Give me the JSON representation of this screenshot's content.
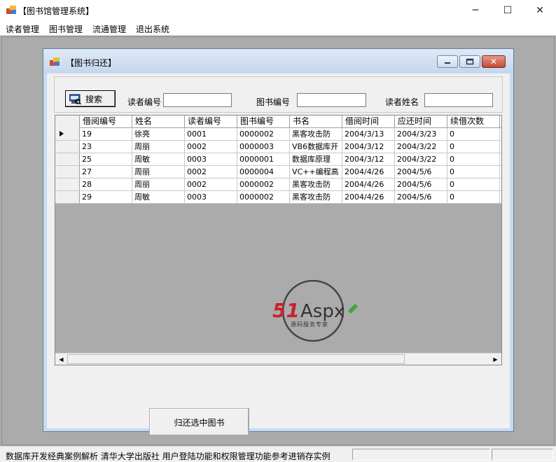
{
  "window": {
    "title": "【图书馆管理系统】",
    "minimize_glyph": "─",
    "maximize_glyph": "☐",
    "close_glyph": "✕"
  },
  "menu": [
    "读者管理",
    "图书管理",
    "流通管理",
    "退出系统"
  ],
  "child": {
    "title": "【图书归还】",
    "close_glyph": "✕"
  },
  "search": {
    "button_label": "搜索",
    "reader_id_label": "读者编号",
    "reader_id_value": "",
    "book_id_label": "图书编号",
    "book_id_value": "",
    "reader_name_label": "读者姓名",
    "reader_name_value": ""
  },
  "grid": {
    "columns": [
      "借阅编号",
      "姓名",
      "读者编号",
      "图书编号",
      "书名",
      "借阅时间",
      "应还时间",
      "续借次数"
    ],
    "rows": [
      [
        "19",
        "徐亮",
        "0001",
        "0000002",
        "黑客攻击防",
        "2004/3/13",
        "2004/3/23",
        "0"
      ],
      [
        "23",
        "周丽",
        "0002",
        "0000003",
        "VB6数据库开",
        "2004/3/12",
        "2004/3/22",
        "0"
      ],
      [
        "25",
        "周敏",
        "0003",
        "0000001",
        "数据库原理",
        "2004/3/12",
        "2004/3/22",
        "0"
      ],
      [
        "27",
        "周丽",
        "0002",
        "0000004",
        "VC++编程高",
        "2004/4/26",
        "2004/5/6",
        "0"
      ],
      [
        "28",
        "周丽",
        "0002",
        "0000002",
        "黑客攻击防",
        "2004/4/26",
        "2004/5/6",
        "0"
      ],
      [
        "29",
        "周敏",
        "0003",
        "0000002",
        "黑客攻击防",
        "2004/4/26",
        "2004/5/6",
        "0"
      ]
    ]
  },
  "watermark": {
    "brand_red": "51",
    "brand_black": "Aspx",
    "slogan": "源码服务专家"
  },
  "return_button_label": "归还选中图书",
  "status": {
    "text": "数据库开发经典案例解析    清华大学出版社    用户登陆功能和权限管理功能参考进销存实例"
  },
  "colors": {
    "accent_red": "#c8232c",
    "accent_green": "#3aa845"
  }
}
